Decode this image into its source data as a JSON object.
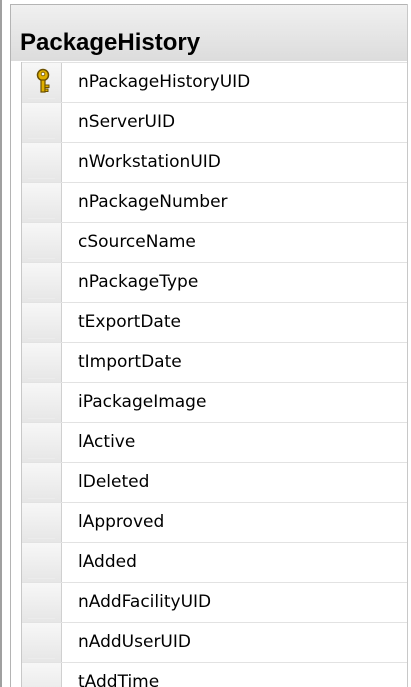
{
  "table": {
    "title": "PackageHistory",
    "primary_key_icon": "primary-key-icon",
    "columns": [
      {
        "name": "nPackageHistoryUID",
        "primary_key": true
      },
      {
        "name": "nServerUID",
        "primary_key": false
      },
      {
        "name": "nWorkstationUID",
        "primary_key": false
      },
      {
        "name": "nPackageNumber",
        "primary_key": false
      },
      {
        "name": "cSourceName",
        "primary_key": false
      },
      {
        "name": "nPackageType",
        "primary_key": false
      },
      {
        "name": "tExportDate",
        "primary_key": false
      },
      {
        "name": "tImportDate",
        "primary_key": false
      },
      {
        "name": "iPackageImage",
        "primary_key": false
      },
      {
        "name": "lActive",
        "primary_key": false
      },
      {
        "name": "lDeleted",
        "primary_key": false
      },
      {
        "name": "lApproved",
        "primary_key": false
      },
      {
        "name": "lAdded",
        "primary_key": false
      },
      {
        "name": "nAddFacilityUID",
        "primary_key": false
      },
      {
        "name": "nAddUserUID",
        "primary_key": false
      },
      {
        "name": "tAddTime",
        "primary_key": false
      }
    ]
  },
  "colors": {
    "key_gold": "#e0b000",
    "key_outline": "#6b5000"
  }
}
